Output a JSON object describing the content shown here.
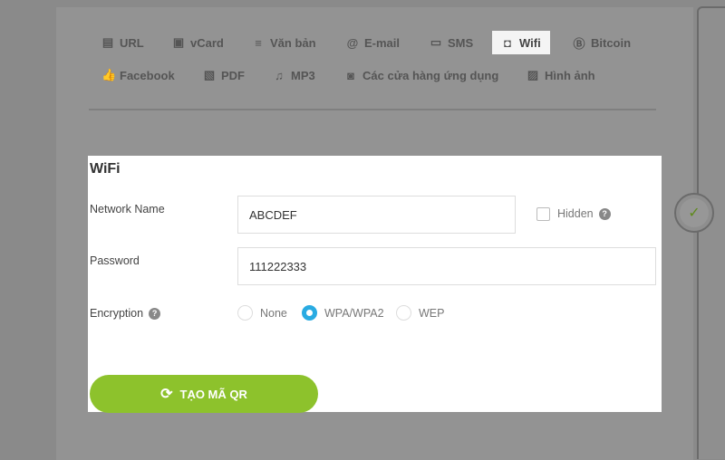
{
  "tabs": [
    {
      "label": "URL",
      "icon": "list-box-icon"
    },
    {
      "label": "vCard",
      "icon": "contact-card-icon"
    },
    {
      "label": "Văn bản",
      "icon": "text-lines-icon"
    },
    {
      "label": "E-mail",
      "icon": "at-icon"
    },
    {
      "label": "SMS",
      "icon": "message-icon"
    },
    {
      "label": "Wifi",
      "icon": "wifi-icon",
      "active": true
    },
    {
      "label": "Bitcoin",
      "icon": "bitcoin-icon"
    },
    {
      "label": "Facebook",
      "icon": "thumbs-up-icon"
    },
    {
      "label": "PDF",
      "icon": "pdf-icon"
    },
    {
      "label": "MP3",
      "icon": "music-note-icon"
    },
    {
      "label": "Các cửa hàng ứng dụng",
      "icon": "app-store-icon"
    },
    {
      "label": "Hình ảnh",
      "icon": "image-icon"
    }
  ],
  "form": {
    "title": "WiFi",
    "network_name_label": "Network Name",
    "network_name_value": "ABCDEF",
    "hidden_label": "Hidden",
    "hidden_checked": false,
    "password_label": "Password",
    "password_value": "111222333",
    "encryption_label": "Encryption",
    "encryption_options": [
      "None",
      "WPA/WPA2",
      "WEP"
    ],
    "encryption_selected": "WPA/WPA2",
    "help_glyph": "?",
    "submit_label": "TẠO MÃ QR"
  },
  "colors": {
    "accent_green": "#8dc22c",
    "radio_blue": "#29abe2"
  }
}
